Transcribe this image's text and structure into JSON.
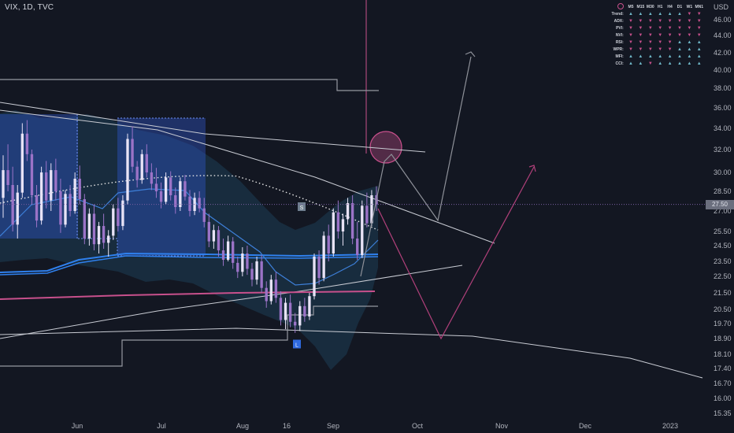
{
  "chart_label": "VIX, 1D, TVC",
  "currency": "USD",
  "last_price": "27.50",
  "colors": {
    "bg": "#131722",
    "bull": "#e8e3f6",
    "bear": "#9b73c7",
    "zone": "#2f55c8",
    "bb": "#2a4a6a",
    "pink": "#c8508c",
    "white": "#c9ccd4",
    "blue": "#2f80ed"
  },
  "panel": {
    "header_icon": "gear-icon",
    "timeframes": [
      "M5",
      "M15",
      "M30",
      "H1",
      "H4",
      "D1",
      "W1",
      "MN1"
    ],
    "rows": [
      {
        "label": "Trend:",
        "signals": [
          "up",
          "up",
          "up",
          "up",
          "up",
          "up",
          "down",
          "down"
        ]
      },
      {
        "label": "ADX:",
        "signals": [
          "down",
          "down",
          "down",
          "down",
          "down",
          "down",
          "down",
          "down"
        ]
      },
      {
        "label": "PVI:",
        "signals": [
          "down",
          "down",
          "down",
          "down",
          "down",
          "down",
          "down",
          "down"
        ]
      },
      {
        "label": "NVI:",
        "signals": [
          "down",
          "down",
          "down",
          "down",
          "down",
          "down",
          "down",
          "down"
        ]
      },
      {
        "label": "RSI:",
        "signals": [
          "down",
          "down",
          "down",
          "down",
          "down",
          "up",
          "up",
          "up"
        ]
      },
      {
        "label": "WPR:",
        "signals": [
          "down",
          "down",
          "down",
          "down",
          "down",
          "up",
          "up",
          "up"
        ]
      },
      {
        "label": "MFI:",
        "signals": [
          "up",
          "up",
          "up",
          "up",
          "up",
          "up",
          "up",
          "up"
        ]
      },
      {
        "label": "CCI:",
        "signals": [
          "up",
          "up",
          "down",
          "up",
          "up",
          "up",
          "up",
          "up"
        ]
      }
    ]
  },
  "chart_data": {
    "type": "candlestick",
    "title": "VIX, 1D, TVC",
    "ylabel": "USD",
    "ylim": [
      15.0,
      47.8
    ],
    "y_ticks": [
      "46.00",
      "44.00",
      "42.00",
      "40.00",
      "38.00",
      "36.00",
      "34.00",
      "32.00",
      "30.00",
      "28.50",
      "27.00",
      "25.50",
      "24.50",
      "23.50",
      "22.50",
      "21.50",
      "20.50",
      "19.70",
      "18.90",
      "18.10",
      "17.40",
      "16.70",
      "16.00",
      "15.35"
    ],
    "x_labels": [
      "Jun",
      "Jul",
      "Aug",
      "16",
      "Sep",
      "Oct",
      "Nov",
      "Dec",
      "2023"
    ],
    "last_price": 27.5,
    "markers": [
      {
        "text": "S",
        "price": 27.3
      },
      {
        "text": "L",
        "price": 18.6
      }
    ],
    "candles": [
      [
        28.0,
        31.5,
        26.5,
        30.2
      ],
      [
        30.2,
        32.5,
        28.5,
        29.0
      ],
      [
        29.0,
        30.5,
        25.5,
        26.0
      ],
      [
        26.0,
        29.0,
        25.0,
        28.4
      ],
      [
        28.4,
        34.5,
        28.0,
        33.5
      ],
      [
        33.5,
        34.8,
        31.0,
        31.6
      ],
      [
        31.6,
        32.0,
        27.5,
        28.2
      ],
      [
        28.2,
        29.0,
        25.8,
        26.3
      ],
      [
        26.3,
        30.5,
        26.0,
        30.0
      ],
      [
        30.0,
        31.0,
        27.2,
        27.8
      ],
      [
        27.8,
        30.8,
        27.0,
        30.2
      ],
      [
        30.2,
        31.2,
        27.8,
        28.5
      ],
      [
        28.5,
        29.5,
        25.4,
        26.0
      ],
      [
        26.0,
        28.6,
        25.8,
        28.3
      ],
      [
        28.3,
        29.0,
        26.6,
        27.0
      ],
      [
        27.0,
        30.0,
        26.8,
        29.5
      ],
      [
        29.5,
        30.6,
        27.5,
        27.9
      ],
      [
        27.9,
        28.3,
        24.6,
        25.0
      ],
      [
        25.0,
        27.2,
        24.5,
        26.8
      ],
      [
        26.8,
        27.5,
        24.2,
        24.6
      ],
      [
        24.6,
        26.2,
        24.0,
        25.9
      ],
      [
        25.9,
        26.8,
        24.3,
        24.7
      ],
      [
        24.7,
        25.6,
        23.8,
        25.2
      ],
      [
        25.2,
        27.5,
        24.9,
        27.2
      ],
      [
        27.2,
        28.0,
        25.5,
        25.9
      ],
      [
        25.9,
        28.2,
        25.6,
        27.8
      ],
      [
        27.8,
        33.5,
        27.5,
        33.0
      ],
      [
        33.0,
        34.2,
        30.0,
        30.5
      ],
      [
        30.5,
        31.0,
        28.8,
        29.4
      ],
      [
        29.4,
        32.0,
        29.1,
        31.6
      ],
      [
        31.6,
        32.5,
        29.6,
        30.0
      ],
      [
        30.0,
        30.8,
        28.6,
        29.1
      ],
      [
        29.1,
        30.4,
        28.0,
        28.5
      ],
      [
        28.5,
        29.2,
        27.2,
        27.7
      ],
      [
        27.7,
        30.0,
        27.5,
        29.6
      ],
      [
        29.6,
        30.1,
        27.8,
        28.2
      ],
      [
        28.2,
        28.8,
        26.8,
        27.3
      ],
      [
        27.3,
        29.6,
        27.0,
        29.3
      ],
      [
        29.3,
        29.8,
        27.8,
        28.1
      ],
      [
        28.1,
        28.6,
        26.6,
        27.0
      ],
      [
        27.0,
        28.4,
        26.7,
        28.0
      ],
      [
        28.0,
        28.5,
        26.9,
        27.2
      ],
      [
        27.2,
        28.0,
        25.8,
        26.2
      ],
      [
        26.2,
        26.8,
        24.4,
        24.8
      ],
      [
        24.8,
        26.0,
        24.3,
        25.6
      ],
      [
        25.6,
        25.9,
        23.8,
        24.2
      ],
      [
        24.2,
        25.0,
        23.2,
        23.6
      ],
      [
        23.6,
        25.2,
        23.5,
        24.8
      ],
      [
        24.8,
        25.1,
        23.0,
        23.4
      ],
      [
        23.4,
        23.8,
        22.4,
        22.8
      ],
      [
        22.8,
        24.4,
        22.5,
        24.0
      ],
      [
        24.0,
        24.5,
        22.6,
        23.0
      ],
      [
        23.0,
        23.4,
        21.9,
        22.3
      ],
      [
        22.3,
        23.8,
        22.0,
        23.5
      ],
      [
        23.5,
        23.9,
        21.5,
        21.8
      ],
      [
        21.8,
        22.2,
        20.6,
        21.0
      ],
      [
        21.0,
        22.6,
        20.8,
        22.3
      ],
      [
        22.3,
        22.8,
        20.9,
        21.2
      ],
      [
        21.2,
        21.6,
        19.6,
        19.9
      ],
      [
        19.9,
        21.2,
        19.4,
        20.9
      ],
      [
        20.9,
        21.4,
        19.5,
        19.8
      ],
      [
        19.8,
        20.3,
        19.2,
        19.6
      ],
      [
        19.6,
        21.0,
        19.3,
        20.7
      ],
      [
        20.7,
        21.2,
        19.8,
        20.1
      ],
      [
        20.1,
        21.5,
        19.9,
        21.3
      ],
      [
        21.3,
        24.0,
        21.1,
        23.8
      ],
      [
        23.8,
        24.2,
        22.0,
        22.4
      ],
      [
        22.4,
        25.5,
        22.2,
        25.2
      ],
      [
        25.2,
        26.0,
        23.5,
        24.0
      ],
      [
        24.0,
        27.2,
        23.8,
        26.9
      ],
      [
        26.9,
        27.8,
        25.0,
        25.5
      ],
      [
        25.5,
        26.8,
        24.5,
        26.4
      ],
      [
        26.4,
        28.0,
        26.0,
        27.6
      ],
      [
        27.6,
        28.2,
        24.6,
        25.0
      ],
      [
        25.0,
        26.2,
        23.6,
        23.9
      ],
      [
        23.9,
        27.8,
        23.7,
        27.4
      ],
      [
        27.4,
        28.4,
        25.8,
        26.1
      ],
      [
        26.1,
        28.6,
        25.9,
        28.2
      ],
      [
        28.2,
        28.9,
        27.0,
        27.5
      ]
    ]
  }
}
